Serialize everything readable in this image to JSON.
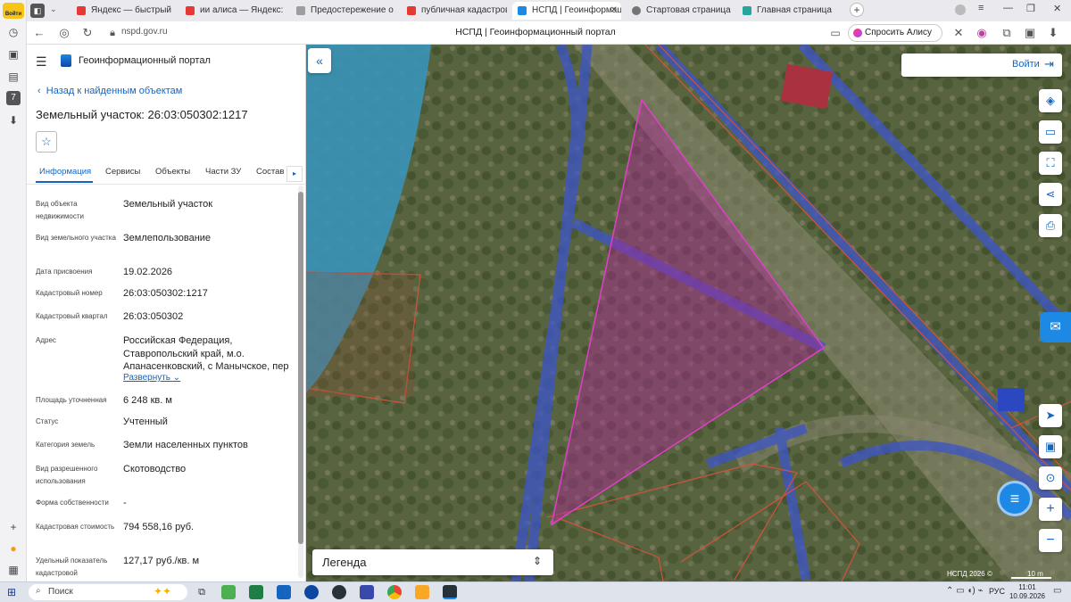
{
  "browser": {
    "side_login_label": "Войти",
    "tabs": [
      {
        "label": "Яндекс — быстрый поиск",
        "color": "#e53935"
      },
      {
        "label": "ии алиса — Яндекс: нашл",
        "color": "#e53935"
      },
      {
        "label": "Предостережение о стро",
        "color": "#9e9e9e"
      },
      {
        "label": "публичная кадастровая к",
        "color": "#e53935"
      },
      {
        "label": "НСПД | Геоинформаци",
        "color": "#1e88e5"
      },
      {
        "label": "Стартовая страница - Ком",
        "color": "#757575"
      },
      {
        "label": "Главная страница",
        "color": "#26a69a"
      }
    ],
    "active_tab_close": "✕",
    "new_tab_icon": "+",
    "url": "nspd.gov.ru",
    "page_title": "НСПД | Геоинформационный портал",
    "alice_label": "Спросить Алису AI"
  },
  "portal": {
    "title": "Геоинформационный портал",
    "back_link": "Назад к найденным объектам",
    "object_title": "Земельный участок: 26:03:050302:1217",
    "tabs": [
      "Информация",
      "Сервисы",
      "Объекты",
      "Части ЗУ",
      "Состав"
    ],
    "fields": [
      {
        "label": "Вид объекта недвижимости",
        "value": "Земельный участок"
      },
      {
        "label": "Вид земельного участка",
        "value": "Землепользование"
      },
      {
        "label": "Дата присвоения",
        "value": "19.02.2026"
      },
      {
        "label": "Кадастровый номер",
        "value": "26:03:050302:1217"
      },
      {
        "label": "Кадастровый квартал",
        "value": "26:03:050302"
      },
      {
        "label": "Адрес",
        "value": "Российская Федерация, Ставропольский край, м.о. Апанасенковский, с Манычское, пер"
      },
      {
        "label": "Площадь уточненная",
        "value": "6 248 кв. м"
      },
      {
        "label": "Статус",
        "value": "Учтенный"
      },
      {
        "label": "Категория земель",
        "value": "Земли населенных пунктов"
      },
      {
        "label": "Вид разрешенного использования",
        "value": "Скотоводство"
      },
      {
        "label": "Форма собственности",
        "value": "-"
      },
      {
        "label": "Кадастровая стоимость",
        "value": "794 558,16 руб."
      },
      {
        "label": "Удельный показатель кадастровой",
        "value": "127,17 руб./кв. м"
      }
    ],
    "expand_label": "Развернуть"
  },
  "map": {
    "login_label": "Войти",
    "legend_label": "Легенда",
    "copyright": "НСПД 2026 ©",
    "scale_label": "10 m",
    "tools": [
      "layers-icon",
      "ruler-icon",
      "select-area-icon",
      "share-icon",
      "print-icon"
    ]
  },
  "taskbar": {
    "search_placeholder": "Поиск",
    "lang": "РУС",
    "time": "11:01",
    "date": "10.09.2026"
  }
}
